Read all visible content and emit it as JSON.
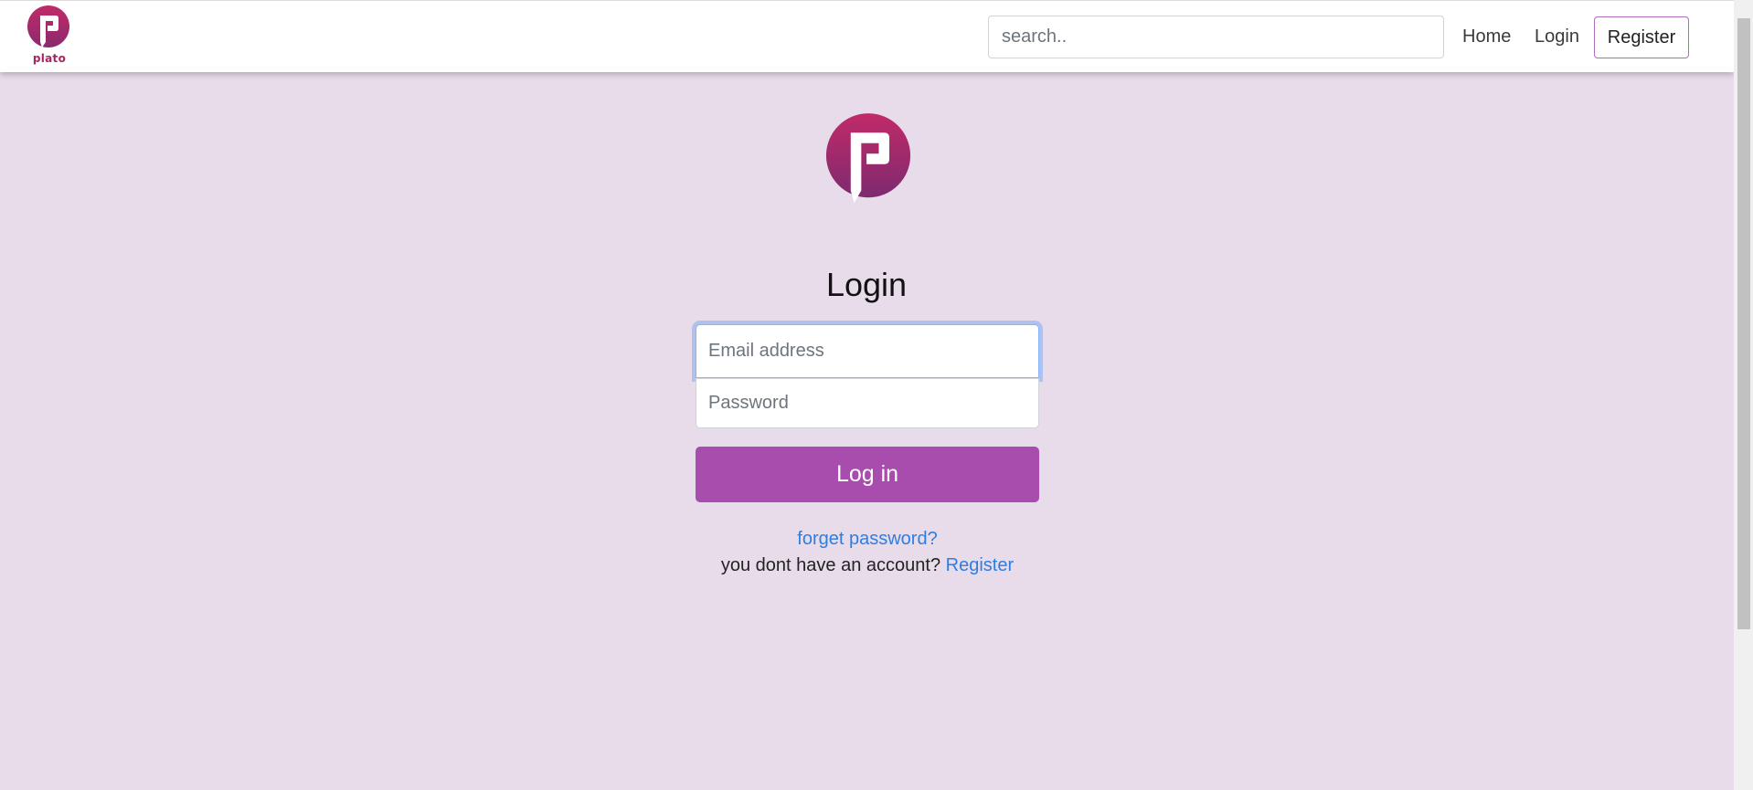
{
  "navbar": {
    "brand_name": "plato",
    "search": {
      "placeholder": "search..",
      "value": ""
    },
    "links": {
      "home": "Home",
      "login": "Login",
      "register": "Register"
    }
  },
  "login": {
    "title": "Login",
    "email": {
      "placeholder": "Email address",
      "value": ""
    },
    "password": {
      "placeholder": "Password",
      "value": ""
    },
    "submit_label": "Log in",
    "forgot_password": "forget password?",
    "no_account_text": "you dont have an account?",
    "register_link": "Register"
  },
  "icons": {
    "brand_logo": "plato-logo-icon",
    "main_logo": "plato-logo-icon"
  },
  "colors": {
    "page_background": "#e8dcea",
    "accent_button": "#a84cad",
    "link": "#2f7de1",
    "logo_primary": "#c12a68",
    "logo_secondary": "#8a2a6e"
  }
}
